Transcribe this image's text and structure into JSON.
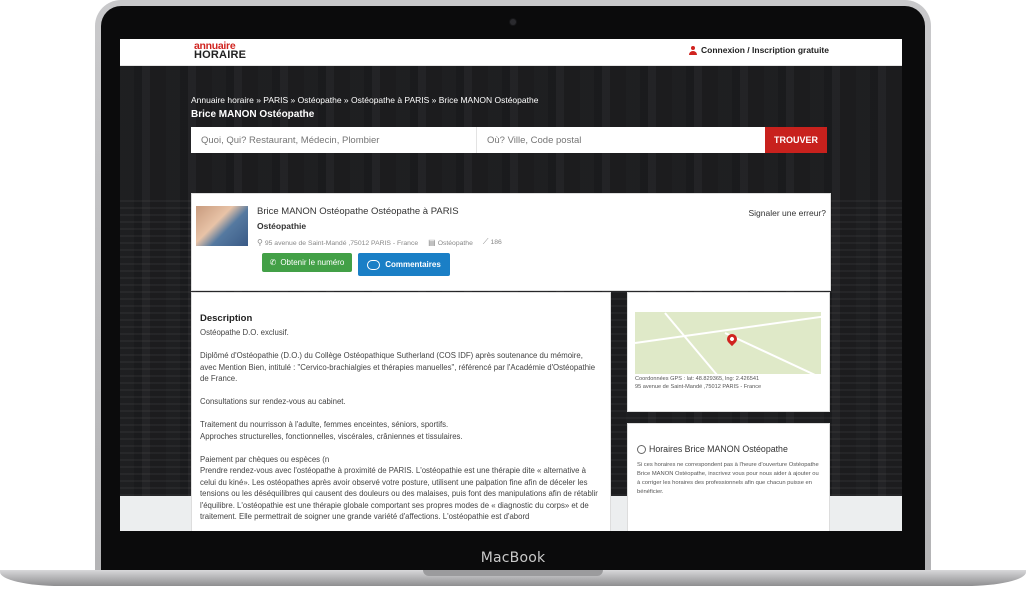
{
  "device": {
    "brand": "MacBook"
  },
  "header": {
    "logo_line1": "annuaire",
    "logo_line2": "HORAIRE",
    "login_label": "Connexion / Inscription gratuite"
  },
  "breadcrumb": {
    "text": "Annuaire horaire  »  PARIS  »  Ostéopathe  »  Ostéopathe à PARIS  »  Brice MANON Ostéopathe"
  },
  "page_title": "Brice MANON Ostéopathe",
  "search": {
    "what_placeholder": "Quoi, Qui? Restaurant, Médecin, Plombier",
    "where_placeholder": "Où? Ville, Code postal",
    "button_label": "TROUVER"
  },
  "listing": {
    "title": "Brice MANON Ostéopathe Ostéopathe à PARIS",
    "category": "Ostéopathie",
    "address": "95 avenue de Saint-Mandé ,75012 PARIS - France",
    "type": "Ostéopathe",
    "views": "186",
    "report_label": "Signaler une erreur?",
    "phone_button": "Obtenir le numéro",
    "comments_button": "Commentaires"
  },
  "description": {
    "title": "Description",
    "body": "Ostéopathe D.O. exclusif.\n\nDiplômé d'Ostéopathie (D.O.) du Collège Ostéopathique Sutherland (COS IDF) après soutenance du mémoire, avec Mention Bien, intitulé : \"Cervico-brachialgies et thérapies manuelles\", référencé par l'Académie d'Ostéopathie de France.\n\nConsultations sur rendez-vous au cabinet.\n\nTraitement du nourrisson à l'adulte, femmes enceintes, séniors, sportifs.\nApproches structurelles, fonctionnelles, viscérales, crâniennes et tissulaires.\n\nPaiement par chèques ou espèces (n\nPrendre rendez-vous avec l'ostéopathe à proximité de PARIS. L'ostéopathie est une thérapie dite « alternative à celui du kiné». Les ostéopathes après avoir observé votre posture, utilisent une palpation fine afin de déceler les tensions ou les déséquilibres qui causent des douleurs ou des malaises, puis font des manipulations afin de rétablir l'équilibre. L'ostéopathie est une thérapie globale comportant ses propres modes de « diagnostic du corps» et de traitement. Elle permettrait de soigner une grande variété d'affections. L'ostéopathie est d'abord"
  },
  "map": {
    "coords": "Coordonnées GPS : lat: 48.829365, lng: 2.426541",
    "address": "95 avenue de Saint-Mandé ,75012 PARIS - France"
  },
  "hours": {
    "title": "Horaires Brice MANON Ostéopathe",
    "body": "Si ces horaires ne correspondent pas à l'heure d'ouverture Ostéopathe Brice MANON Ostéopathe, inscrivez vous pour nous aider à ajouter ou à corriger les horaires des professionnels afin que chacun puisse en bénéficier."
  },
  "colors": {
    "brand_red": "#c8211d",
    "phone_green": "#43a047",
    "comments_blue": "#1a7fc6"
  }
}
